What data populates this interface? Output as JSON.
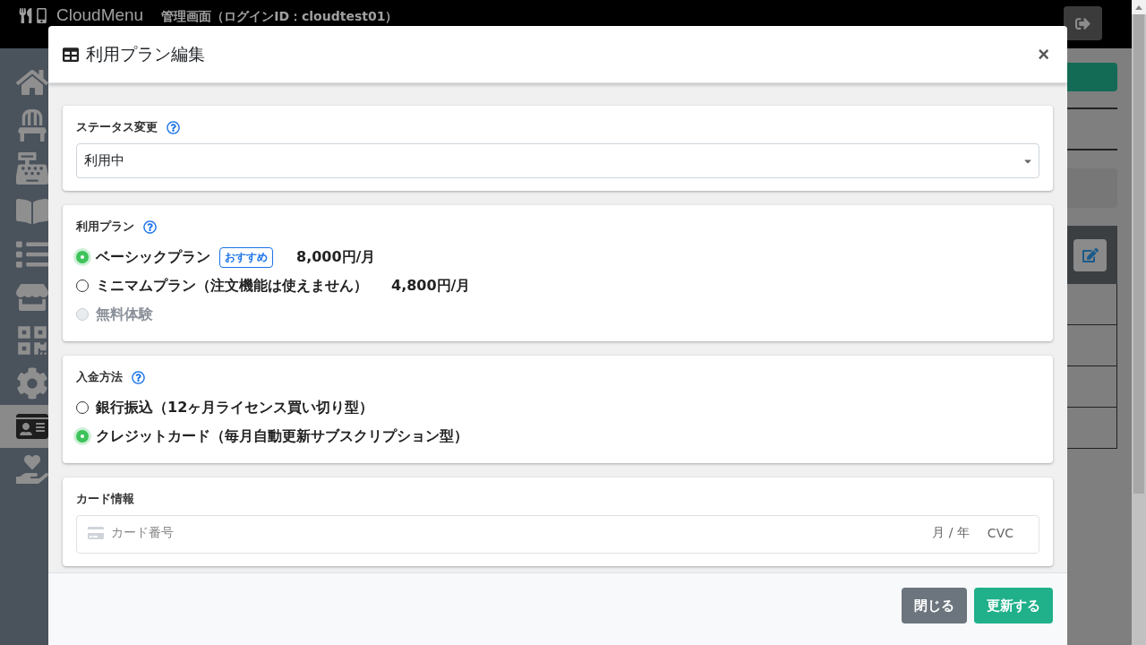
{
  "header": {
    "brand": "CloudMenu",
    "subtitle": "管理画面（ログインID：cloudtest01）"
  },
  "sidebar": {
    "items": [
      {
        "selected": false
      },
      {
        "selected": false
      },
      {
        "selected": false
      },
      {
        "selected": false
      },
      {
        "selected": false
      },
      {
        "selected": false
      },
      {
        "selected": false
      },
      {
        "selected": false
      },
      {
        "selected": true
      },
      {
        "selected": false
      }
    ]
  },
  "modal": {
    "title": "利用プラン編集",
    "close": "×",
    "sections": [
      {
        "kind": "select",
        "label": "ステータス変更",
        "help": true,
        "value": "利用中"
      },
      {
        "kind": "radios",
        "label": "利用プラン",
        "help": true,
        "options": [
          {
            "label": "ベーシックプラン",
            "badge": "おすすめ",
            "price": "8,000円/月",
            "selected": true,
            "disabled": false
          },
          {
            "label": "ミニマムプラン（注文機能は使えません）",
            "price": "4,800円/月",
            "selected": false,
            "disabled": false
          },
          {
            "label": "無料体験",
            "selected": false,
            "disabled": true
          }
        ]
      },
      {
        "kind": "radios",
        "label": "入金方法",
        "help": true,
        "options": [
          {
            "label": "銀行振込（12ヶ月ライセンス買い切り型）",
            "selected": false,
            "disabled": false
          },
          {
            "label": "クレジットカード（毎月自動更新サブスクリプション型）",
            "selected": true,
            "disabled": false
          }
        ]
      },
      {
        "kind": "card",
        "label": "カード情報",
        "help": false,
        "placeholder": "カード番号",
        "expiry": "月 / 年",
        "cvc": "CVC"
      }
    ],
    "buttons": [
      {
        "label": "閉じる",
        "kind": "secondary"
      },
      {
        "label": "更新する",
        "kind": "primary"
      }
    ]
  }
}
